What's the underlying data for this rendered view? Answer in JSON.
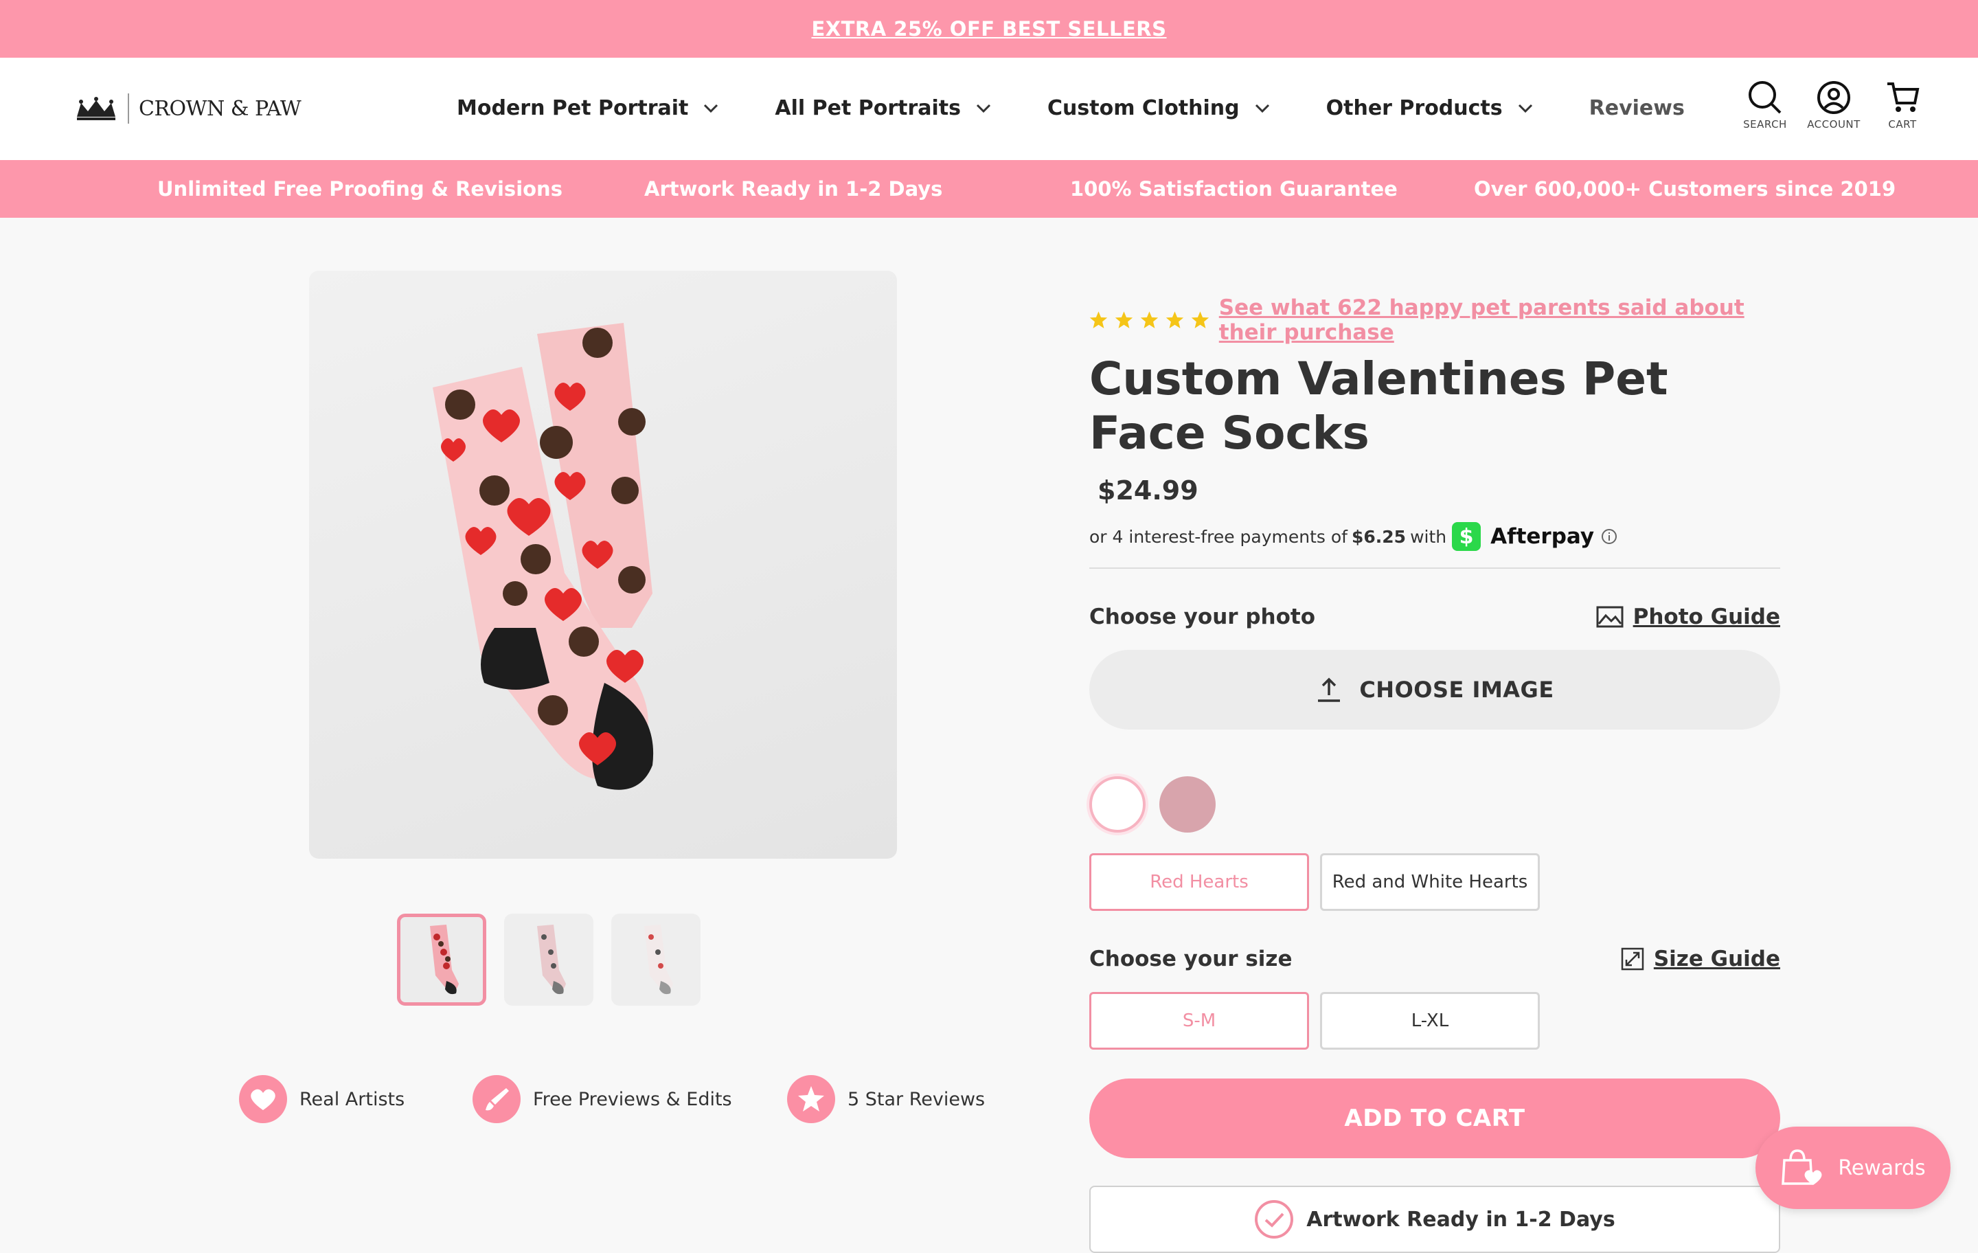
{
  "promo": {
    "text": "EXTRA 25% OFF BEST SELLERS"
  },
  "logo": {
    "text": "CROWN & PAW"
  },
  "nav": {
    "items": [
      {
        "label": "Modern Pet Portrait"
      },
      {
        "label": "All Pet Portraits"
      },
      {
        "label": "Custom Clothing"
      },
      {
        "label": "Other Products"
      },
      {
        "label": "Reviews"
      }
    ]
  },
  "header_icons": {
    "search": "SEARCH",
    "account": "ACCOUNT",
    "cart": "CART"
  },
  "features": [
    "Unlimited Free Proofing & Revisions",
    "Artwork Ready in 1-2 Days",
    "100% Satisfaction Guarantee",
    "Over 600,000+ Customers since 2019"
  ],
  "badges": [
    {
      "label": "Real Artists",
      "icon": "heart-icon"
    },
    {
      "label": "Free Previews & Edits",
      "icon": "paintbrush-icon"
    },
    {
      "label": "5 Star Reviews",
      "icon": "star-icon"
    }
  ],
  "product": {
    "rating": 5,
    "reviews_link": "See what 622 happy pet parents said about their purchase",
    "title": "Custom Valentines Pet Face Socks",
    "price": "$24.99",
    "afterpay": {
      "prefix": "or 4 interest-free payments of",
      "amount": "$6.25",
      "with": "with",
      "brand": "Afterpay"
    },
    "photo_label": "Choose your photo",
    "photo_guide": "Photo Guide",
    "choose_image": "CHOOSE IMAGE",
    "styles": [
      "Red Hearts",
      "Red and White Hearts"
    ],
    "size_label": "Choose your size",
    "size_guide": "Size Guide",
    "sizes": [
      "S-M",
      "L-XL"
    ],
    "add_to_cart": "ADD TO CART",
    "ready_text": "Artwork Ready in 1-2 Days"
  },
  "rewards": {
    "label": "Rewards"
  },
  "colors": {
    "brand_pink": "#fd97ab",
    "accent_pink": "#f28fa3",
    "afterpay_green": "#2bd84a"
  }
}
